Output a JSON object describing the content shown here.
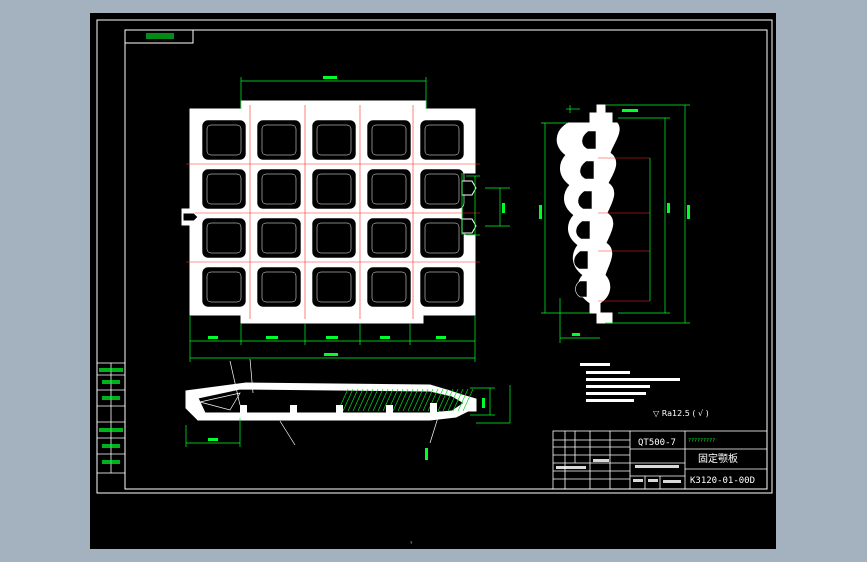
{
  "colors": {
    "viewport_bg": "#000000",
    "frame": "#ffffff",
    "part": "#ffffff",
    "center_line": "#ff2a2a",
    "dimension": "#00ff2a",
    "hatch": "#00e020",
    "outer_bg": "#a4b2bf"
  },
  "title_block": {
    "material": "QT500-7",
    "company_note": "?????????",
    "part_name": "固定颚板",
    "drawing_number": "K3120-01-00D"
  },
  "stamp_label": "?",
  "surface_finish": "▽ Ra12.5 ( √ )"
}
